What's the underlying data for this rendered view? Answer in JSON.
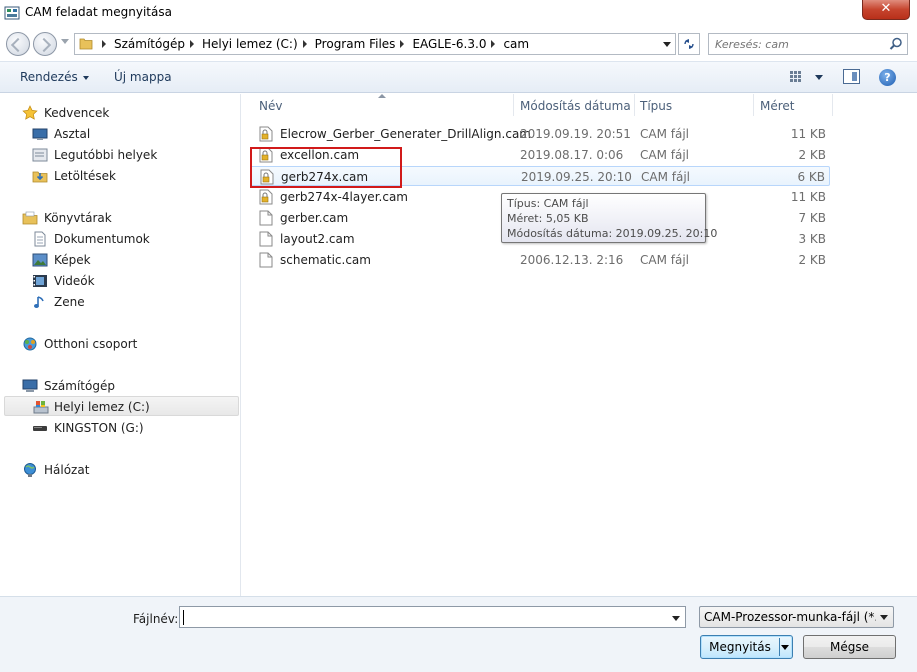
{
  "window": {
    "title": "CAM feladat megnyitása",
    "close_label": "✕"
  },
  "address": {
    "crumbs": [
      "Számítógép",
      "Helyi lemez (C:)",
      "Program Files",
      "EAGLE-6.3.0",
      "cam"
    ],
    "search_placeholder": "Keresés: cam"
  },
  "toolbar": {
    "organize_label": "Rendezés",
    "new_folder_label": "Új mappa",
    "help_label": "?"
  },
  "sidebar": {
    "items": [
      {
        "label": "Kedvencek",
        "icon": "star-icon"
      },
      {
        "label": "Asztal",
        "icon": "desktop-icon"
      },
      {
        "label": "Legutóbbi helyek",
        "icon": "recent-places-icon"
      },
      {
        "label": "Letöltések",
        "icon": "downloads-icon"
      },
      {
        "label": "Könyvtárak",
        "icon": "libraries-icon"
      },
      {
        "label": "Dokumentumok",
        "icon": "documents-icon"
      },
      {
        "label": "Képek",
        "icon": "pictures-icon"
      },
      {
        "label": "Videók",
        "icon": "videos-icon"
      },
      {
        "label": "Zene",
        "icon": "music-icon"
      },
      {
        "label": "Otthoni csoport",
        "icon": "homegroup-icon"
      },
      {
        "label": "Számítógép",
        "icon": "computer-icon"
      },
      {
        "label": "Helyi lemez (C:)",
        "icon": "local-disk-icon",
        "selected": true
      },
      {
        "label": "KINGSTON (G:)",
        "icon": "usb-drive-icon"
      },
      {
        "label": "Hálózat",
        "icon": "network-icon"
      }
    ]
  },
  "files": {
    "columns": [
      "Név",
      "Módosítás dátuma",
      "Típus",
      "Méret"
    ],
    "rows": [
      {
        "name": "Elecrow_Gerber_Generater_DrillAlign.cam",
        "date": "2019.09.19. 20:51",
        "type": "CAM fájl",
        "size": "11 KB",
        "locked": true
      },
      {
        "name": "excellon.cam",
        "date": "2019.08.17. 0:06",
        "type": "CAM fájl",
        "size": "2 KB",
        "locked": true
      },
      {
        "name": "gerb274x.cam",
        "date": "2019.09.25. 20:10",
        "type": "CAM fájl",
        "size": "6 KB",
        "locked": true
      },
      {
        "name": "gerb274x-4layer.cam",
        "date": "",
        "type": "",
        "size": "11 KB",
        "locked": true
      },
      {
        "name": "gerber.cam",
        "date": "",
        "type": "",
        "size": "7 KB",
        "locked": false
      },
      {
        "name": "layout2.cam",
        "date": "",
        "type": "",
        "size": "3 KB",
        "locked": false
      },
      {
        "name": "schematic.cam",
        "date": "2006.12.13. 2:16",
        "type": "CAM fájl",
        "size": "2 KB",
        "locked": false
      }
    ],
    "hovered_row": 2
  },
  "tooltip": {
    "type_line": "Típus: CAM fájl",
    "size_line": "Méret: 5,05 KB",
    "date_line": "Módosítás dátuma: 2019.09.25. 20:10"
  },
  "bottom": {
    "filename_label": "Fájlnév:",
    "filename_value": "",
    "filter_value": "CAM-Prozessor-munka-fájl (*.cam)",
    "open_label": "Megnyitás",
    "cancel_label": "Mégse"
  },
  "colors": {
    "highlight_border": "#d11a1a",
    "hover_border": "#b8d6fb",
    "accent": "#1e395b"
  }
}
